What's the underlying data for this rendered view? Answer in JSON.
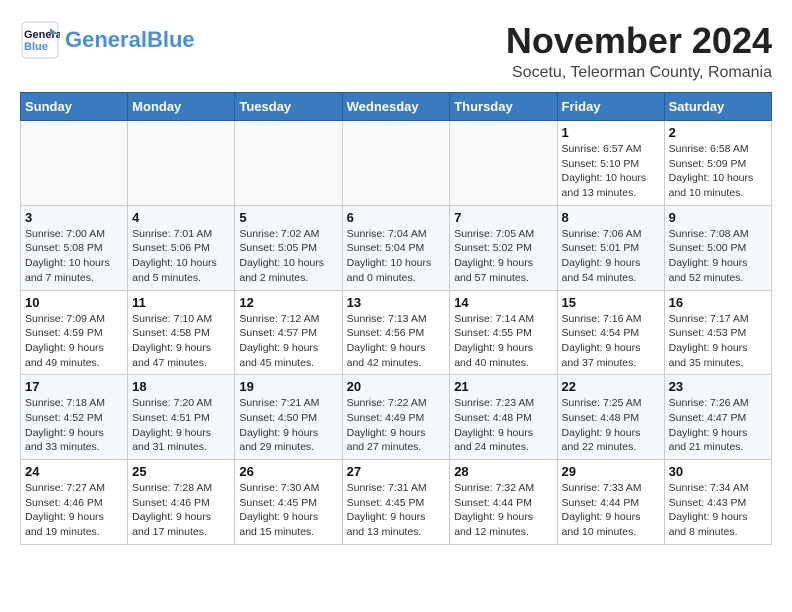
{
  "logo": {
    "line1": "General",
    "line2": "Blue"
  },
  "title": "November 2024",
  "location": "Socetu, Teleorman County, Romania",
  "days_of_week": [
    "Sunday",
    "Monday",
    "Tuesday",
    "Wednesday",
    "Thursday",
    "Friday",
    "Saturday"
  ],
  "weeks": [
    [
      {
        "day": "",
        "info": ""
      },
      {
        "day": "",
        "info": ""
      },
      {
        "day": "",
        "info": ""
      },
      {
        "day": "",
        "info": ""
      },
      {
        "day": "",
        "info": ""
      },
      {
        "day": "1",
        "info": "Sunrise: 6:57 AM\nSunset: 5:10 PM\nDaylight: 10 hours and 13 minutes."
      },
      {
        "day": "2",
        "info": "Sunrise: 6:58 AM\nSunset: 5:09 PM\nDaylight: 10 hours and 10 minutes."
      }
    ],
    [
      {
        "day": "3",
        "info": "Sunrise: 7:00 AM\nSunset: 5:08 PM\nDaylight: 10 hours and 7 minutes."
      },
      {
        "day": "4",
        "info": "Sunrise: 7:01 AM\nSunset: 5:06 PM\nDaylight: 10 hours and 5 minutes."
      },
      {
        "day": "5",
        "info": "Sunrise: 7:02 AM\nSunset: 5:05 PM\nDaylight: 10 hours and 2 minutes."
      },
      {
        "day": "6",
        "info": "Sunrise: 7:04 AM\nSunset: 5:04 PM\nDaylight: 10 hours and 0 minutes."
      },
      {
        "day": "7",
        "info": "Sunrise: 7:05 AM\nSunset: 5:02 PM\nDaylight: 9 hours and 57 minutes."
      },
      {
        "day": "8",
        "info": "Sunrise: 7:06 AM\nSunset: 5:01 PM\nDaylight: 9 hours and 54 minutes."
      },
      {
        "day": "9",
        "info": "Sunrise: 7:08 AM\nSunset: 5:00 PM\nDaylight: 9 hours and 52 minutes."
      }
    ],
    [
      {
        "day": "10",
        "info": "Sunrise: 7:09 AM\nSunset: 4:59 PM\nDaylight: 9 hours and 49 minutes."
      },
      {
        "day": "11",
        "info": "Sunrise: 7:10 AM\nSunset: 4:58 PM\nDaylight: 9 hours and 47 minutes."
      },
      {
        "day": "12",
        "info": "Sunrise: 7:12 AM\nSunset: 4:57 PM\nDaylight: 9 hours and 45 minutes."
      },
      {
        "day": "13",
        "info": "Sunrise: 7:13 AM\nSunset: 4:56 PM\nDaylight: 9 hours and 42 minutes."
      },
      {
        "day": "14",
        "info": "Sunrise: 7:14 AM\nSunset: 4:55 PM\nDaylight: 9 hours and 40 minutes."
      },
      {
        "day": "15",
        "info": "Sunrise: 7:16 AM\nSunset: 4:54 PM\nDaylight: 9 hours and 37 minutes."
      },
      {
        "day": "16",
        "info": "Sunrise: 7:17 AM\nSunset: 4:53 PM\nDaylight: 9 hours and 35 minutes."
      }
    ],
    [
      {
        "day": "17",
        "info": "Sunrise: 7:18 AM\nSunset: 4:52 PM\nDaylight: 9 hours and 33 minutes."
      },
      {
        "day": "18",
        "info": "Sunrise: 7:20 AM\nSunset: 4:51 PM\nDaylight: 9 hours and 31 minutes."
      },
      {
        "day": "19",
        "info": "Sunrise: 7:21 AM\nSunset: 4:50 PM\nDaylight: 9 hours and 29 minutes."
      },
      {
        "day": "20",
        "info": "Sunrise: 7:22 AM\nSunset: 4:49 PM\nDaylight: 9 hours and 27 minutes."
      },
      {
        "day": "21",
        "info": "Sunrise: 7:23 AM\nSunset: 4:48 PM\nDaylight: 9 hours and 24 minutes."
      },
      {
        "day": "22",
        "info": "Sunrise: 7:25 AM\nSunset: 4:48 PM\nDaylight: 9 hours and 22 minutes."
      },
      {
        "day": "23",
        "info": "Sunrise: 7:26 AM\nSunset: 4:47 PM\nDaylight: 9 hours and 21 minutes."
      }
    ],
    [
      {
        "day": "24",
        "info": "Sunrise: 7:27 AM\nSunset: 4:46 PM\nDaylight: 9 hours and 19 minutes."
      },
      {
        "day": "25",
        "info": "Sunrise: 7:28 AM\nSunset: 4:46 PM\nDaylight: 9 hours and 17 minutes."
      },
      {
        "day": "26",
        "info": "Sunrise: 7:30 AM\nSunset: 4:45 PM\nDaylight: 9 hours and 15 minutes."
      },
      {
        "day": "27",
        "info": "Sunrise: 7:31 AM\nSunset: 4:45 PM\nDaylight: 9 hours and 13 minutes."
      },
      {
        "day": "28",
        "info": "Sunrise: 7:32 AM\nSunset: 4:44 PM\nDaylight: 9 hours and 12 minutes."
      },
      {
        "day": "29",
        "info": "Sunrise: 7:33 AM\nSunset: 4:44 PM\nDaylight: 9 hours and 10 minutes."
      },
      {
        "day": "30",
        "info": "Sunrise: 7:34 AM\nSunset: 4:43 PM\nDaylight: 9 hours and 8 minutes."
      }
    ]
  ]
}
